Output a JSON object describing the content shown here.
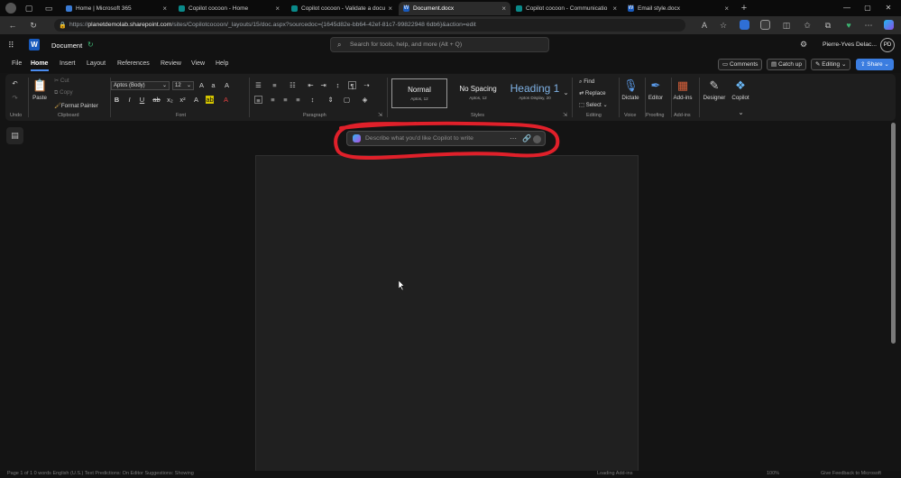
{
  "browser": {
    "tabs": [
      {
        "label": "Home | Microsoft 365",
        "active": false,
        "favicon_color": "#3a7bd5"
      },
      {
        "label": "Copilot cocoon - Home",
        "active": false,
        "favicon_color": "#0a8a8a"
      },
      {
        "label": "Copilot cocoon - Validate a docu",
        "active": false,
        "favicon_color": "#0a8a8a"
      },
      {
        "label": "Document.docx",
        "active": true,
        "favicon_color": "#185abd"
      },
      {
        "label": "Copilot cocoon - Communicatio",
        "active": false,
        "favicon_color": "#0a8a8a"
      },
      {
        "label": "Email style.docx",
        "active": false,
        "favicon_color": "#185abd"
      }
    ],
    "new_tab": "+",
    "url_prefix": "https://",
    "url_host": "planetdemolab.sharepoint.com",
    "url_path": "/sites/Copilotcocoon/_layouts/15/doc.aspx?sourcedoc={1645d82e-bb64-42ef-81c7-99822948 6db6}&action=edit"
  },
  "office": {
    "doc_title": "Document",
    "search_placeholder": "Search for tools, help, and more (Alt + Q)",
    "user_name": "Pierre-Yves Delac...",
    "user_initials": "PD"
  },
  "menu": {
    "tabs": [
      "File",
      "Home",
      "Insert",
      "Layout",
      "References",
      "Review",
      "View",
      "Help"
    ],
    "selected": "Home",
    "comments": "Comments",
    "catchup": "Catch up",
    "editing": "Editing",
    "share": "Share"
  },
  "ribbon": {
    "undo_group": "Undo",
    "paste": "Paste",
    "cut": "Cut",
    "copy": "Copy",
    "format_painter": "Format Painter",
    "clipboard_group": "Clipboard",
    "font_name": "Aptos (Body)",
    "font_size": "12",
    "font_group": "Font",
    "paragraph_group": "Paragraph",
    "styles": [
      {
        "name": "Normal",
        "sub": "Aptos, 12"
      },
      {
        "name": "No Spacing",
        "sub": "Aptos, 12"
      },
      {
        "name": "Heading 1",
        "sub": "Aptos Display, 20"
      }
    ],
    "styles_group": "Styles",
    "find": "Find",
    "replace": "Replace",
    "select": "Select",
    "editing_group": "Editing",
    "dictate": "Dictate",
    "voice_group": "Voice",
    "editor": "Editor",
    "proofing_group": "Proofing",
    "addins": "Add-ins",
    "addins_group": "Add-ins",
    "designer": "Designer",
    "copilot": "Copilot"
  },
  "copilot_prompt": {
    "placeholder": "Describe what you'd like Copilot to write",
    "annotation_color": "#e0202a"
  },
  "status": {
    "left": "Page 1 of 1    0 words    English (U.S.)    Text Predictions: On    Editor Suggestions: Showing",
    "mid": "Loading Add-ins",
    "zoom": "100%",
    "feedback": "Give Feedback to Microsoft"
  },
  "colors": {
    "accent_share": "#3b7de0",
    "word_blue": "#185abd"
  }
}
